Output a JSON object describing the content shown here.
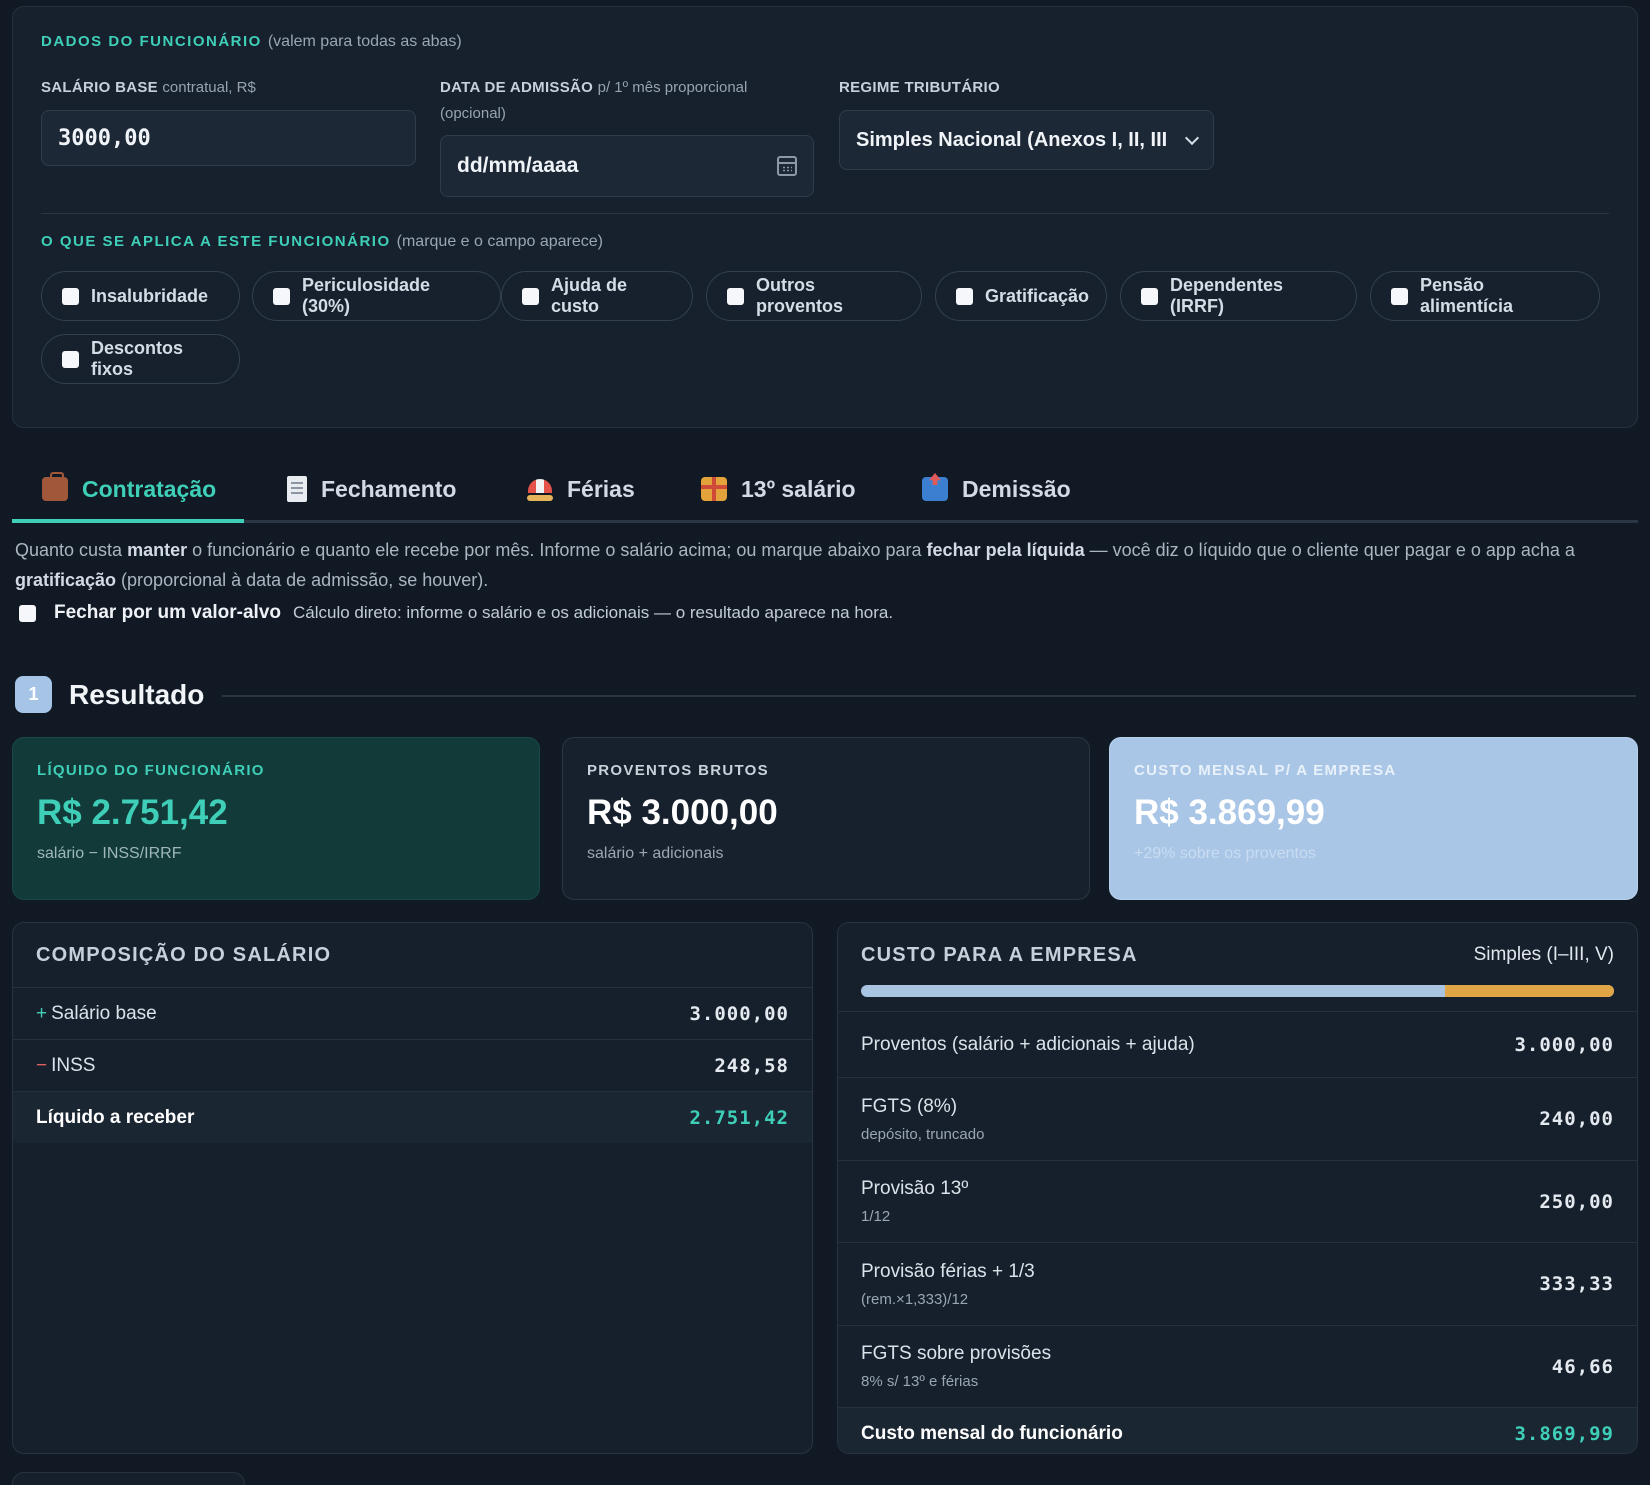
{
  "employee": {
    "section_title": "DADOS DO FUNCIONÁRIO",
    "section_note": "(valem para todas as abas)",
    "salary": {
      "label": "SALÁRIO BASE",
      "hint": "contratual, R$",
      "value": "3000,00"
    },
    "admission": {
      "label": "DATA DE ADMISSÃO",
      "hint": "p/ 1º mês proporcional",
      "hint2": "(opcional)",
      "placeholder": "dd/mm/aaaa",
      "icon": "calendar-icon"
    },
    "regime": {
      "label": "REGIME TRIBUTÁRIO",
      "selected": "Simples Nacional (Anexos I, II, III"
    }
  },
  "applies": {
    "title": "O QUE SE APLICA A ESTE FUNCIONÁRIO",
    "note": "(marque e o campo aparece)",
    "options": [
      "Insalubridade",
      "Periculosidade (30%)",
      "Ajuda de custo",
      "Outros proventos",
      "Gratificação",
      "Dependentes (IRRF)",
      "Pensão alimentícia",
      "Descontos fixos"
    ]
  },
  "tabs": [
    {
      "label": "Contratação",
      "icon": "briefcase-icon",
      "active": true
    },
    {
      "label": "Fechamento",
      "icon": "receipt-icon"
    },
    {
      "label": "Férias",
      "icon": "beach-umbrella-icon"
    },
    {
      "label": "13º salário",
      "icon": "gift-icon"
    },
    {
      "label": "Demissão",
      "icon": "outbox-icon"
    }
  ],
  "intro": {
    "p1": "Quanto custa ",
    "b1": "manter",
    "p2": " o funcionário e quanto ele recebe por mês. Informe o salário acima; ou marque abaixo para ",
    "b2": "fechar pela líquida",
    "p3": " — você diz o líquido que o cliente quer pagar e o app acha a ",
    "b3": "gratificação",
    "p4": " (proporcional à data de admissão, se houver)."
  },
  "target": {
    "label": "Fechar por um valor-alvo",
    "help": "Cálculo direto: informe o salário e os adicionais — o resultado aparece na hora."
  },
  "result": {
    "step": "1",
    "title": "Resultado"
  },
  "cards": {
    "net": {
      "label": "LÍQUIDO DO FUNCIONÁRIO",
      "value": "R$ 2.751,42",
      "sub": "salário − INSS/IRRF"
    },
    "gross": {
      "label": "PROVENTOS BRUTOS",
      "value": "R$ 3.000,00",
      "sub": "salário + adicionais"
    },
    "cost": {
      "label": "CUSTO MENSAL P/ A EMPRESA",
      "value": "R$ 3.869,99",
      "sub": "+29% sobre os proventos"
    }
  },
  "composition": {
    "title": "COMPOSIÇÃO DO SALÁRIO",
    "rows": [
      {
        "sign": "+",
        "label": "Salário base",
        "value": "3.000,00"
      },
      {
        "sign": "−",
        "label": "INSS",
        "value": "248,58"
      }
    ],
    "total": {
      "label": "Líquido a receber",
      "value": "2.751,42"
    }
  },
  "company_cost": {
    "title": "CUSTO PARA A EMPRESA",
    "regime": "Simples (I–III, V)",
    "bar_proventos_fraction": 0.775,
    "colors": {
      "proventos": "#a9c4e3",
      "encargos": "#e0a544",
      "accent": "#3fcfb8"
    },
    "rows": [
      {
        "label": "Proventos (salário + adicionais + ajuda)",
        "sub": "",
        "value": "3.000,00"
      },
      {
        "label": "FGTS (8%)",
        "sub": "depósito, truncado",
        "value": "240,00"
      },
      {
        "label": "Provisão 13º",
        "sub": "1/12",
        "value": "250,00"
      },
      {
        "label": "Provisão férias + 1/3",
        "sub": "(rem.×1,333)/12",
        "value": "333,33"
      },
      {
        "label": "FGTS sobre provisões",
        "sub": "8% s/ 13º e férias",
        "value": "46,66"
      }
    ],
    "total": {
      "label": "Custo mensal do funcionário",
      "value": "3.869,99"
    }
  }
}
